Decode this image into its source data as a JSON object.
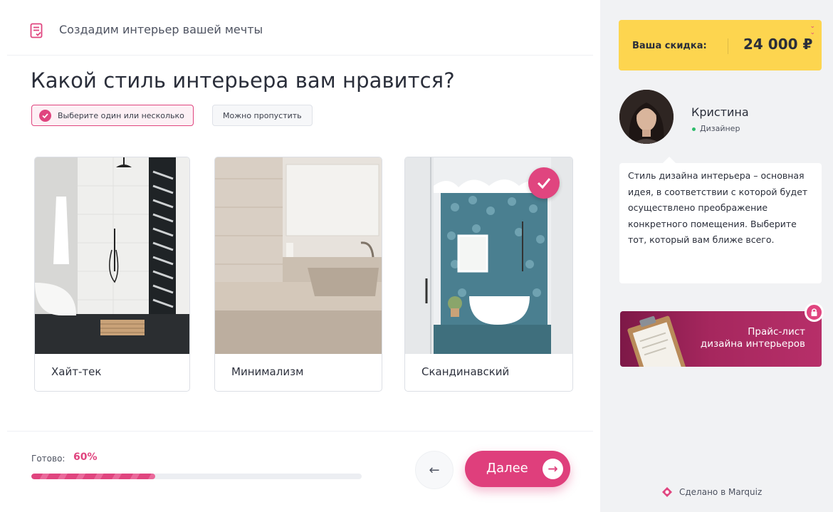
{
  "header": {
    "title": "Создадим интерьер вашей мечты"
  },
  "question": {
    "title": "Какой стиль интерьера вам нравится?",
    "hint": "Выберите один или несколько",
    "skip": "Можно пропустить"
  },
  "options": [
    {
      "label": "Хайт-тек",
      "selected": false
    },
    {
      "label": "Минимализм",
      "selected": false
    },
    {
      "label": "Скандинавский",
      "selected": true
    }
  ],
  "progress": {
    "label": "Готово:",
    "value_text": "60%",
    "value": 0.6
  },
  "nav": {
    "next_label": "Далее",
    "back_icon": "arrow-left-icon",
    "next_icon": "arrow-right-icon"
  },
  "sidebar": {
    "discount_label": "Ваша скидка:",
    "discount_value": "24 000 ₽",
    "consultant_name": "Кристина",
    "consultant_role": "Дизайнер",
    "message": "Стиль дизайна интерьера – основная идея, в соответствии с которой будет осуществлено преображение конкретного помещения. Выберите тот, который вам ближе всего.",
    "pricelist_line1": "Прайс-лист",
    "pricelist_line2": "дизайна интерьеров",
    "made_in": "Сделано в Marquiz"
  },
  "colors": {
    "accent": "#e0457f",
    "discount_bg": "#fdd54f",
    "sidebar_bg": "#f1f2f4",
    "online": "#2ebb6a"
  }
}
